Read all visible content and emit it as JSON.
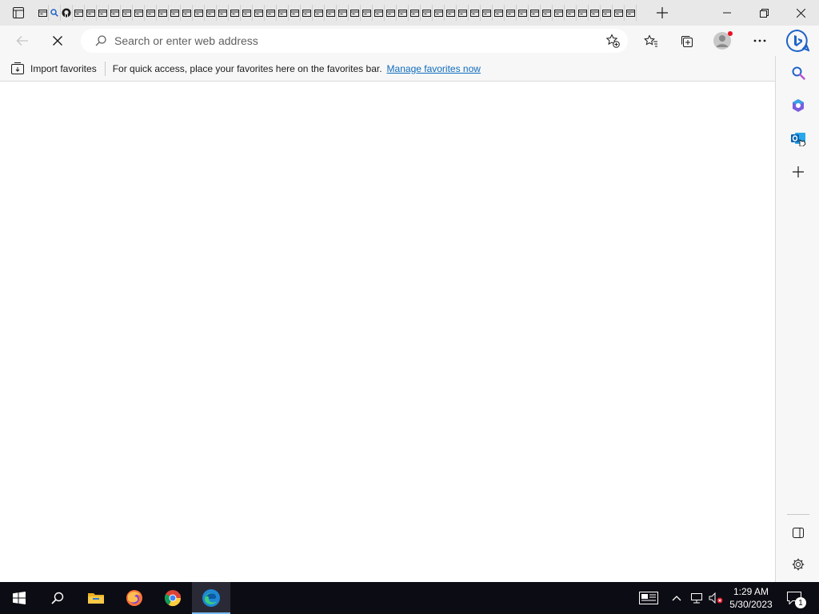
{
  "window": {
    "tab_count": 50,
    "new_tab_icon": "plus-icon",
    "minimize_icon": "minimize-icon",
    "restore_icon": "restore-icon",
    "close_icon": "close-icon"
  },
  "toolbar": {
    "back_icon": "back-arrow-icon",
    "stop_icon": "stop-loading-icon",
    "address_placeholder": "Search or enter web address",
    "address_value": "",
    "favorite_star_icon": "add-favorite-star-icon",
    "favorites_icon": "favorites-icon",
    "collections_icon": "collections-icon",
    "profile_icon": "profile-avatar-icon",
    "more_icon": "more-options-icon",
    "bing_icon": "bing-chat-icon"
  },
  "favorites_bar": {
    "import_label": "Import favorites",
    "message": "For quick access, place your favorites here on the favorites bar.",
    "manage_link": "Manage favorites now"
  },
  "sidebar": {
    "items": [
      "search-icon",
      "office-icon",
      "outlook-icon",
      "add-icon"
    ],
    "hide_sidebar_icon": "sidebar-toggle-icon",
    "settings_icon": "settings-gear-icon"
  },
  "taskbar": {
    "apps": [
      "start-icon",
      "search-icon",
      "file-explorer-icon",
      "firefox-icon",
      "chrome-icon",
      "edge-icon"
    ],
    "time": "1:29 AM",
    "date": "5/30/2023",
    "notification_count": "1",
    "colors": {
      "background": "#0c0c14",
      "active_underline": "#76b9ed"
    }
  }
}
